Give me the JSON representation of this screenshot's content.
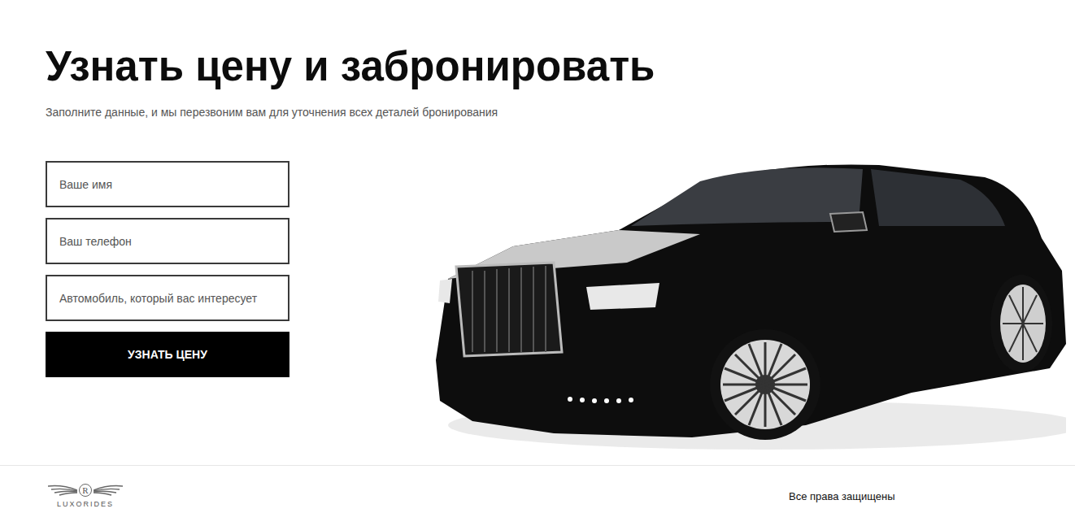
{
  "heading": "Узнать цену и забронировать",
  "subtitle": "Заполните данные, и мы перезвоним вам для уточнения всех деталей бронирования",
  "form": {
    "fields": [
      {
        "placeholder": "Ваше имя"
      },
      {
        "placeholder": "Ваш телефон"
      },
      {
        "placeholder": "Автомобиль, который вас интересует"
      }
    ],
    "button": "УЗНАТЬ ЦЕНУ"
  },
  "footer": {
    "logo": {
      "monogram": "R",
      "name": "LUXORIDES"
    },
    "copyright": "Все права защищены"
  }
}
